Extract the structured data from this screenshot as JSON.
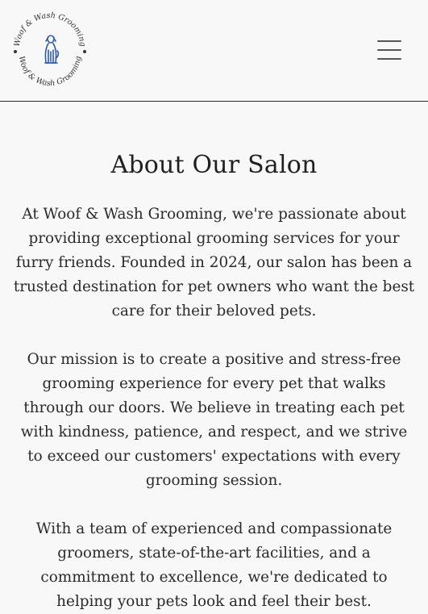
{
  "header": {
    "logo_text_top": "Woof & Wash Grooming",
    "logo_text_bottom": "Woof & Wash Grooming",
    "logo_icon": "dog-icon",
    "menu_icon": "hamburger-menu-icon"
  },
  "colors": {
    "background": "#f8f8f9",
    "logo_blue": "#2f5aa8",
    "text": "#2a2a2a",
    "divider": "#2b2b2b"
  },
  "main": {
    "title": "About Our Salon",
    "paragraphs": [
      "At Woof & Wash Grooming, we're passionate about providing exceptional grooming services for your furry friends. Founded in 2024, our salon has been a trusted destination for pet owners who want the best care for their beloved pets.",
      "Our mission is to create a positive and stress-free grooming experience for every pet that walks through our doors. We believe in treating each pet with kindness, patience, and respect, and we strive to exceed our customers' expectations with every grooming session.",
      "With a team of experienced and compassionate groomers, state-of-the-art facilities, and a commitment to excellence, we're dedicated to helping your pets look and feel their best."
    ]
  }
}
